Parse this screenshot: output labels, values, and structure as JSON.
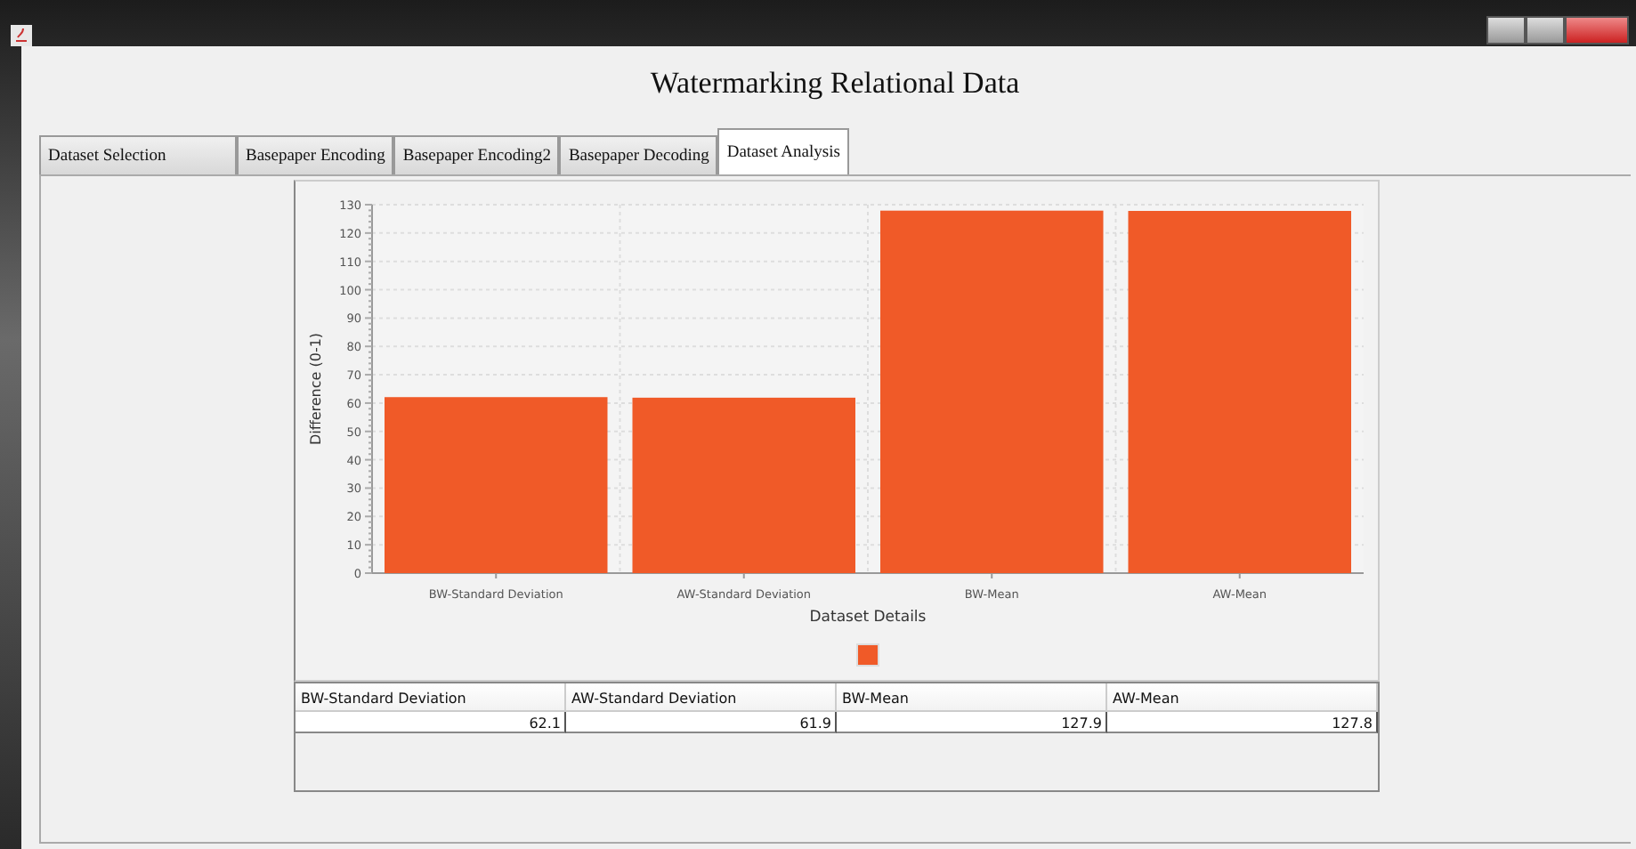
{
  "window": {
    "title": "Watermarking Relational Data"
  },
  "tabs": [
    {
      "label": "Dataset Selection",
      "selected": false
    },
    {
      "label": "Basepaper Encoding",
      "selected": false
    },
    {
      "label": "Basepaper Encoding2",
      "selected": false
    },
    {
      "label": "Basepaper Decoding",
      "selected": false
    },
    {
      "label": "Dataset Analysis",
      "selected": true
    }
  ],
  "chart": {
    "chart_data": {
      "type": "bar",
      "xlabel": "Dataset Details",
      "ylabel": "Difference (0-1)",
      "categories": [
        "BW-Standard Deviation",
        "AW-Standard Deviation",
        "BW-Mean",
        "AW-Mean"
      ],
      "series": [
        {
          "color": "#f05a28",
          "values": [
            62.1,
            61.9,
            127.9,
            127.8
          ]
        }
      ],
      "grid": true,
      "ylim": [
        0,
        130
      ],
      "yticks": [
        0,
        10,
        20,
        30,
        40,
        50,
        60,
        70,
        80,
        90,
        100,
        110,
        120,
        130
      ]
    }
  },
  "table": {
    "columns": [
      "BW-Standard Deviation",
      "AW-Standard Deviation",
      "BW-Mean",
      "AW-Mean"
    ],
    "rows": [
      [
        "62.1",
        "61.9",
        "127.9",
        "127.8"
      ]
    ]
  }
}
